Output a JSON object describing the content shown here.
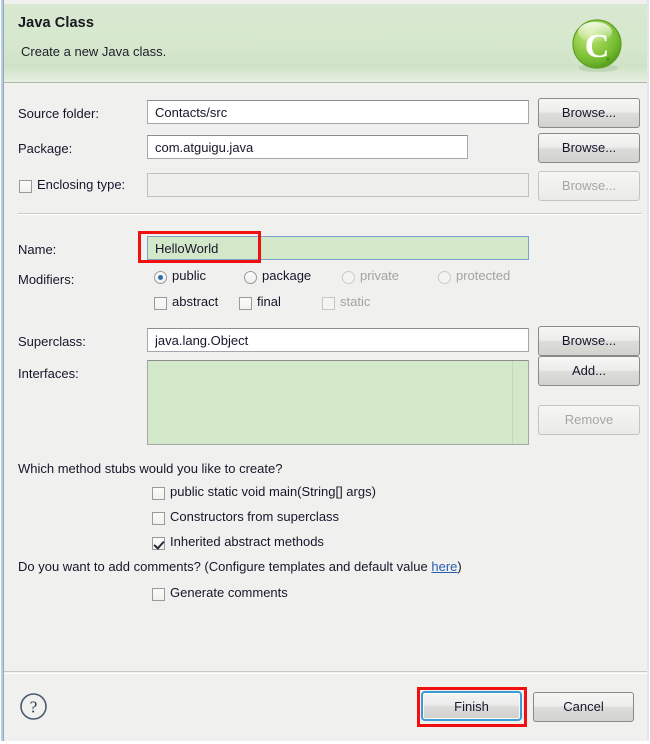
{
  "dialog": {
    "header": {
      "title": "Java Class",
      "subtitle": "Create a new Java class.",
      "icon": "java-class-green-c-icon",
      "background_color": "#d5e7cd"
    },
    "fields": {
      "source_folder": {
        "label": "Source folder:",
        "value": "Contacts/src",
        "browse_label": "Browse...",
        "enabled": true
      },
      "package": {
        "label": "Package:",
        "value": "com.atguigu.java",
        "browse_label": "Browse...",
        "enabled": true
      },
      "enclosing_type": {
        "label": "Enclosing type:",
        "value": "",
        "checked": false,
        "browse_label": "Browse...",
        "enabled": false
      },
      "name": {
        "label": "Name:",
        "value": "HelloWorld",
        "focused": true,
        "highlight_color": "#d3e7c9"
      },
      "superclass": {
        "label": "Superclass:",
        "value": "java.lang.Object",
        "browse_label": "Browse...",
        "enabled": true
      },
      "interfaces": {
        "label": "Interfaces:",
        "items": [],
        "add_label": "Add...",
        "remove_label": "Remove",
        "remove_enabled": false
      }
    },
    "modifiers": {
      "label": "Modifiers:",
      "access": [
        {
          "label": "public",
          "selected": true,
          "enabled": true
        },
        {
          "label": "package",
          "selected": false,
          "enabled": true
        },
        {
          "label": "private",
          "selected": false,
          "enabled": false
        },
        {
          "label": "protected",
          "selected": false,
          "enabled": false
        }
      ],
      "flags": [
        {
          "label": "abstract",
          "checked": false,
          "enabled": true
        },
        {
          "label": "final",
          "checked": false,
          "enabled": true
        },
        {
          "label": "static",
          "checked": false,
          "enabled": false
        }
      ]
    },
    "method_stubs": {
      "prompt": "Which method stubs would you like to create?",
      "options": [
        {
          "label": "public static void main(String[] args)",
          "checked": false
        },
        {
          "label": "Constructors from superclass",
          "checked": false
        },
        {
          "label": "Inherited abstract methods",
          "checked": true
        }
      ]
    },
    "comments": {
      "prompt_before": "Do you want to add comments? (Configure templates and default value ",
      "link_label": "here",
      "prompt_after": ")",
      "option": {
        "label": "Generate comments",
        "checked": false
      }
    },
    "footer": {
      "help_icon": "question-mark-help-icon",
      "finish_label": "Finish",
      "cancel_label": "Cancel",
      "default_button": "Finish"
    },
    "annotations": {
      "color": "#f01010",
      "regions": [
        "name-field-highlight",
        "finish-button-highlight"
      ]
    }
  }
}
